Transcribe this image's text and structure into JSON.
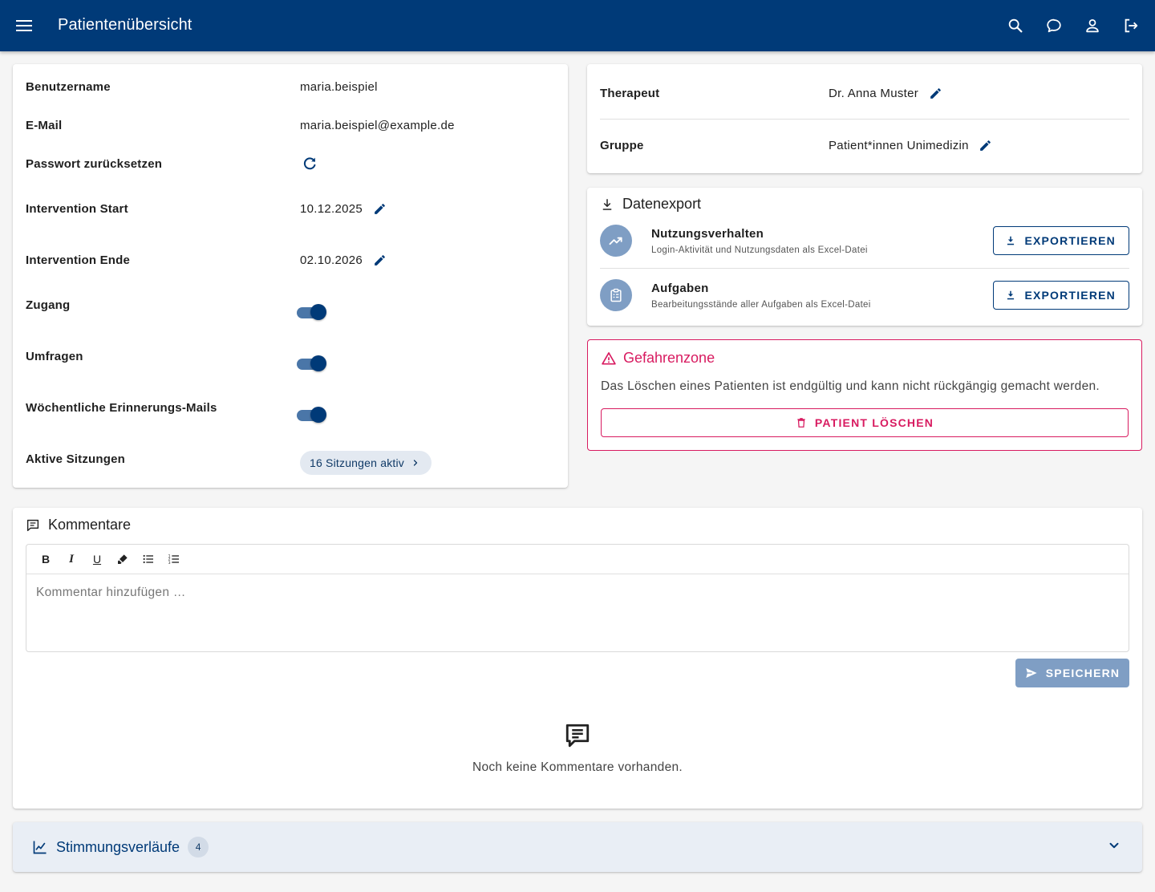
{
  "appbar": {
    "title": "Patientenübersicht",
    "icons": [
      "menu-icon",
      "search-icon",
      "chat-icon",
      "account-icon",
      "logout-icon"
    ]
  },
  "details": {
    "username_label": "Benutzername",
    "username_value": "maria.beispiel",
    "email_label": "E-Mail",
    "email_value": "maria.beispiel@example.de",
    "password_label": "Passwort zurücksetzen",
    "start_label": "Intervention Start",
    "start_value": "10.12.2025",
    "end_label": "Intervention Ende",
    "end_value": "02.10.2026",
    "access_label": "Zugang",
    "access_on": true,
    "surveys_label": "Umfragen",
    "surveys_on": true,
    "reminder_label": "Wöchentliche Erinnerungs-Mails",
    "reminder_on": true,
    "sessions_label": "Aktive Sitzungen",
    "sessions_value": "16 Sitzungen aktiv"
  },
  "therapist": {
    "therapist_label": "Therapeut",
    "therapist_value": "Dr. Anna Muster",
    "group_label": "Gruppe",
    "group_value": "Patient*innen Unimedizin"
  },
  "export": {
    "title": "Datenexport",
    "items": [
      {
        "title": "Nutzungsverhalten",
        "subtitle": "Login-Aktivität und Nutzungsdaten als Excel-Datei",
        "button": "EXPORTIEREN"
      },
      {
        "title": "Aufgaben",
        "subtitle": "Bearbeitungsstände aller Aufgaben als Excel-Datei",
        "button": "EXPORTIEREN"
      }
    ]
  },
  "danger": {
    "title": "Gefahrenzone",
    "description": "Das Löschen eines Patienten ist endgültig und kann nicht rückgängig gemacht werden.",
    "button": "PATIENT LÖSCHEN"
  },
  "comments": {
    "title": "Kommentare",
    "placeholder": "Kommentar hinzufügen …",
    "toolbar": {
      "bold": "B",
      "italic": "I",
      "underline": "U"
    },
    "save_button": "SPEICHERN",
    "empty_text": "Noch keine Kommentare vorhanden."
  },
  "mood": {
    "title": "Stimmungsverläufe",
    "count": "4"
  },
  "colors": {
    "primary": "#003a78",
    "danger": "#d81b60",
    "muted_primary": "#7f9ec4"
  }
}
